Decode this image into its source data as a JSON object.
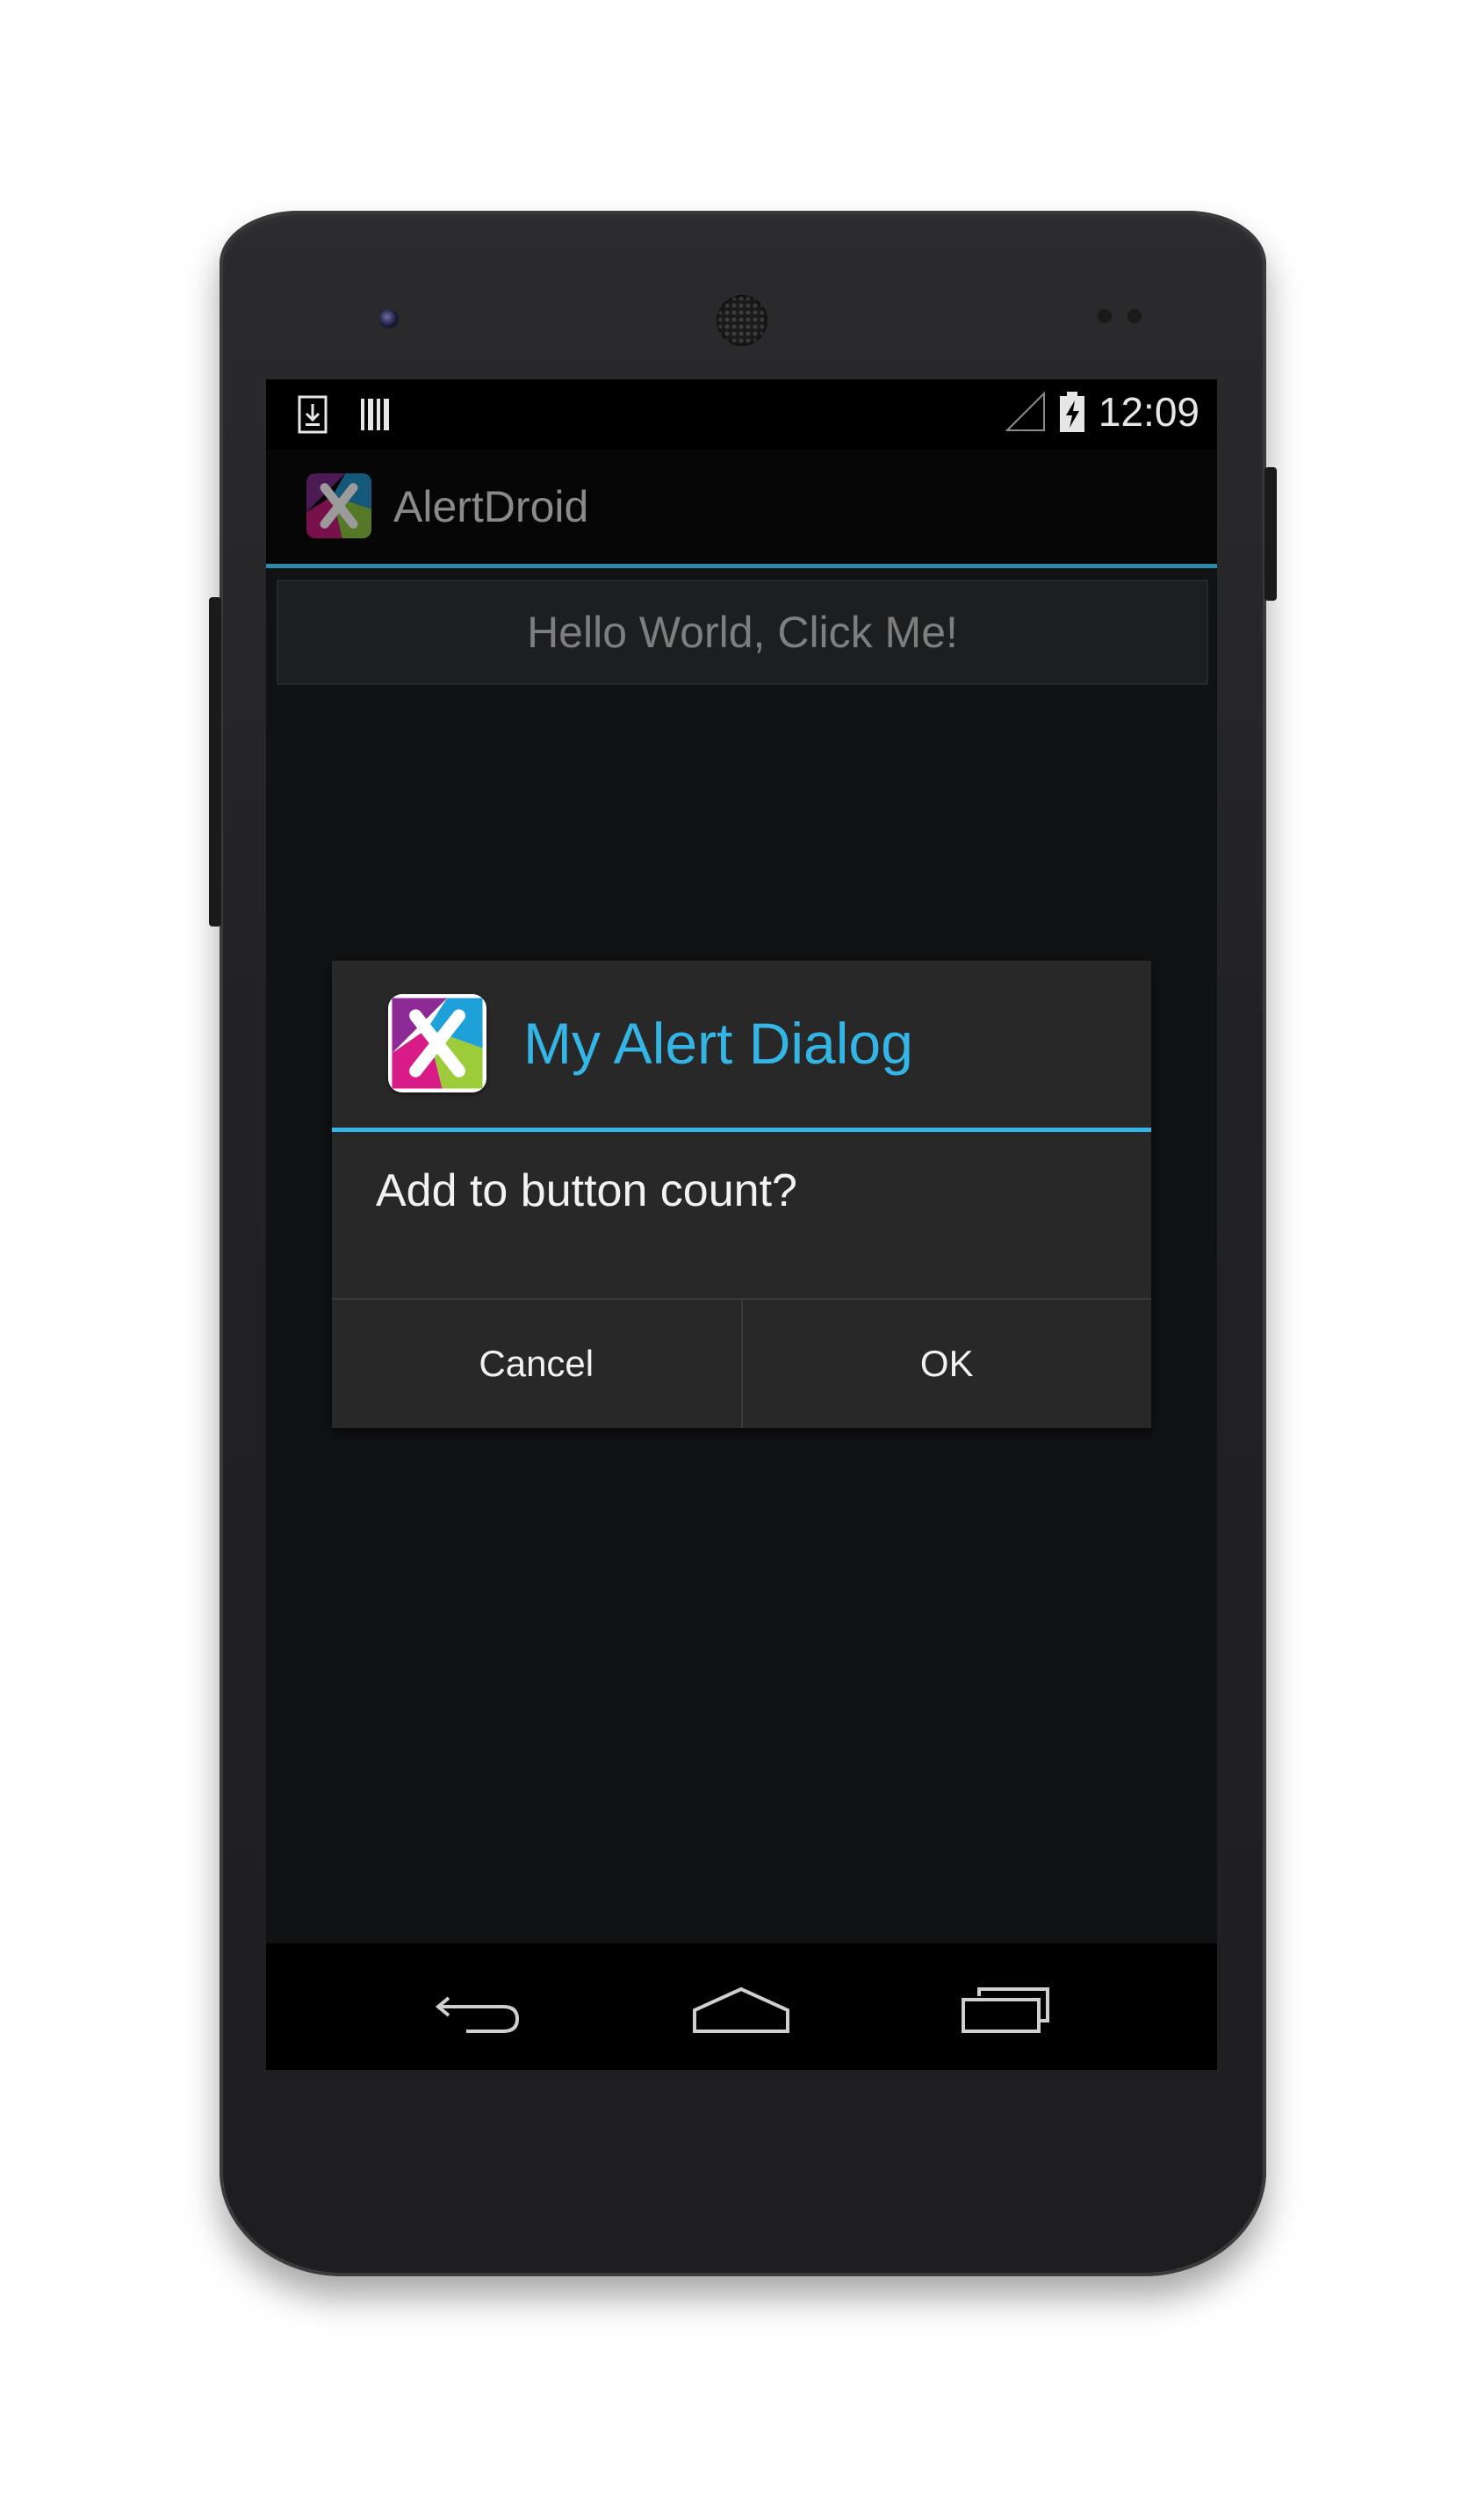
{
  "status_bar": {
    "time": "12:09",
    "left_icons": [
      "download-notification-icon",
      "barcode-notification-icon"
    ],
    "right_icons": [
      "signal-icon",
      "battery-charging-icon"
    ]
  },
  "action_bar": {
    "app_icon": "app-logo-icon",
    "title": "AlertDroid"
  },
  "main": {
    "button_label": "Hello World, Click Me!"
  },
  "dialog": {
    "icon": "app-logo-icon",
    "title": "My Alert Dialog",
    "message": "Add to button count?",
    "negative_label": "Cancel",
    "positive_label": "OK",
    "accent_color": "#33b5e5"
  },
  "nav_bar": {
    "buttons": [
      "back-icon",
      "home-icon",
      "recent-apps-icon"
    ]
  }
}
